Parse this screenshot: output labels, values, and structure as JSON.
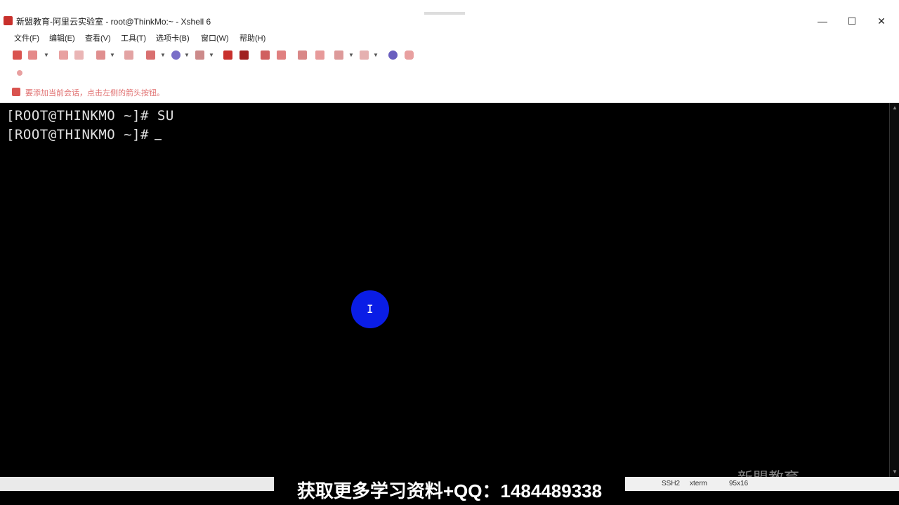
{
  "window": {
    "title": "新盟教育-阿里云实验室 - root@ThinkMo:~ - Xshell 6",
    "controls": {
      "minimize": "—",
      "maximize": "☐",
      "close": "✕"
    }
  },
  "menu": {
    "items": [
      {
        "label": "文件(F)"
      },
      {
        "label": "编辑(E)"
      },
      {
        "label": "查看(V)"
      },
      {
        "label": "工具(T)"
      },
      {
        "label": "选项卡(B)"
      },
      {
        "label": "窗口(W)"
      },
      {
        "label": "帮助(H)"
      }
    ]
  },
  "toolbar": {
    "icons": [
      "new-session-icon",
      "open-icon",
      "reconnect-icon",
      "disconnect-icon",
      "properties-icon",
      "find-icon",
      "transfer-icon",
      "globe-icon",
      "script-icon",
      "color-icon",
      "lock-icon",
      "fullscreen-icon",
      "keyboard-icon",
      "help-icon",
      "chat-icon"
    ]
  },
  "notice": {
    "text": "要添加当前会话，点击左侧的箭头按钮。"
  },
  "terminal": {
    "lines": [
      "[ROOT@THINKMO ~]# SU",
      "[ROOT@THINKMO ~]#"
    ]
  },
  "status": {
    "protocol": "SSH2",
    "term": "xterm",
    "size": "95x16"
  },
  "watermark": {
    "text": "新盟教育"
  },
  "banner": {
    "text": "获取更多学习资料+QQ：1484489338"
  }
}
